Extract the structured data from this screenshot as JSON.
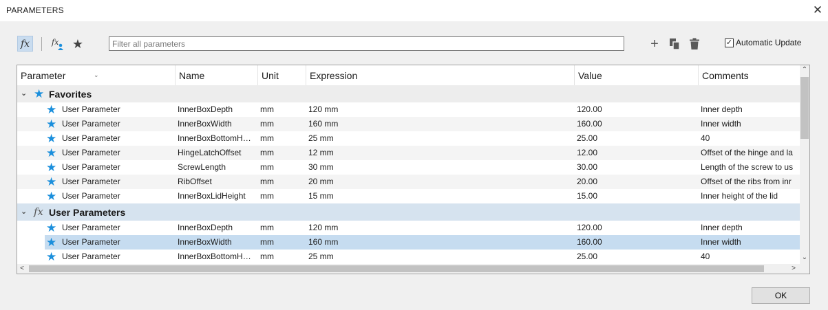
{
  "window": {
    "title": "PARAMETERS",
    "close_glyph": "✕"
  },
  "toolbar": {
    "fx_label": "fx",
    "star_glyph": "★",
    "filter_placeholder": "Filter all parameters",
    "add_glyph": "+",
    "auto_update_label": "Automatic Update",
    "auto_update_checked": true,
    "check_glyph": "✓"
  },
  "table": {
    "headers": {
      "parameter": "Parameter",
      "name": "Name",
      "unit": "Unit",
      "expression": "Expression",
      "value": "Value",
      "comments": "Comments"
    },
    "groups": {
      "favorites": {
        "label": "Favorites",
        "chevron": "⌄",
        "icon": "★"
      },
      "user": {
        "label": "User Parameters",
        "chevron": "⌄",
        "icon": "fx"
      }
    },
    "favorites_rows": [
      {
        "param": "User Parameter",
        "name": "InnerBoxDepth",
        "unit": "mm",
        "expr": "120 mm",
        "value": "120.00",
        "comment": "Inner depth"
      },
      {
        "param": "User Parameter",
        "name": "InnerBoxWidth",
        "unit": "mm",
        "expr": "160 mm",
        "value": "160.00",
        "comment": "Inner width"
      },
      {
        "param": "User Parameter",
        "name": "InnerBoxBottomH…",
        "unit": "mm",
        "expr": "25 mm",
        "value": "25.00",
        "comment": "40"
      },
      {
        "param": "User Parameter",
        "name": "HingeLatchOffset",
        "unit": "mm",
        "expr": "12 mm",
        "value": "12.00",
        "comment": "Offset of the hinge and la"
      },
      {
        "param": "User Parameter",
        "name": "ScrewLength",
        "unit": "mm",
        "expr": "30 mm",
        "value": "30.00",
        "comment": "Length of the screw to us"
      },
      {
        "param": "User Parameter",
        "name": "RibOffset",
        "unit": "mm",
        "expr": "20 mm",
        "value": "20.00",
        "comment": "Offset of the ribs from inr"
      },
      {
        "param": "User Parameter",
        "name": "InnerBoxLidHeight",
        "unit": "mm",
        "expr": "15 mm",
        "value": "15.00",
        "comment": "Inner height of the lid"
      }
    ],
    "user_rows": [
      {
        "param": "User Parameter",
        "name": "InnerBoxDepth",
        "unit": "mm",
        "expr": "120 mm",
        "value": "120.00",
        "comment": "Inner depth"
      },
      {
        "param": "User Parameter",
        "name": "InnerBoxWidth",
        "unit": "mm",
        "expr": "160 mm",
        "value": "160.00",
        "comment": "Inner width"
      },
      {
        "param": "User Parameter",
        "name": "InnerBoxBottomH…",
        "unit": "mm",
        "expr": "25 mm",
        "value": "25.00",
        "comment": "40"
      }
    ],
    "row_star_glyph": "★",
    "selected_user_row_index": 1
  },
  "scroll": {
    "up": "⌃",
    "down": "⌄",
    "left": "<",
    "right": ">"
  },
  "footer": {
    "ok_label": "OK"
  },
  "colors": {
    "accent_star": "#1b8fdc",
    "selected_row": "#c6dcf0",
    "user_group_bg": "#d6e3ef"
  }
}
